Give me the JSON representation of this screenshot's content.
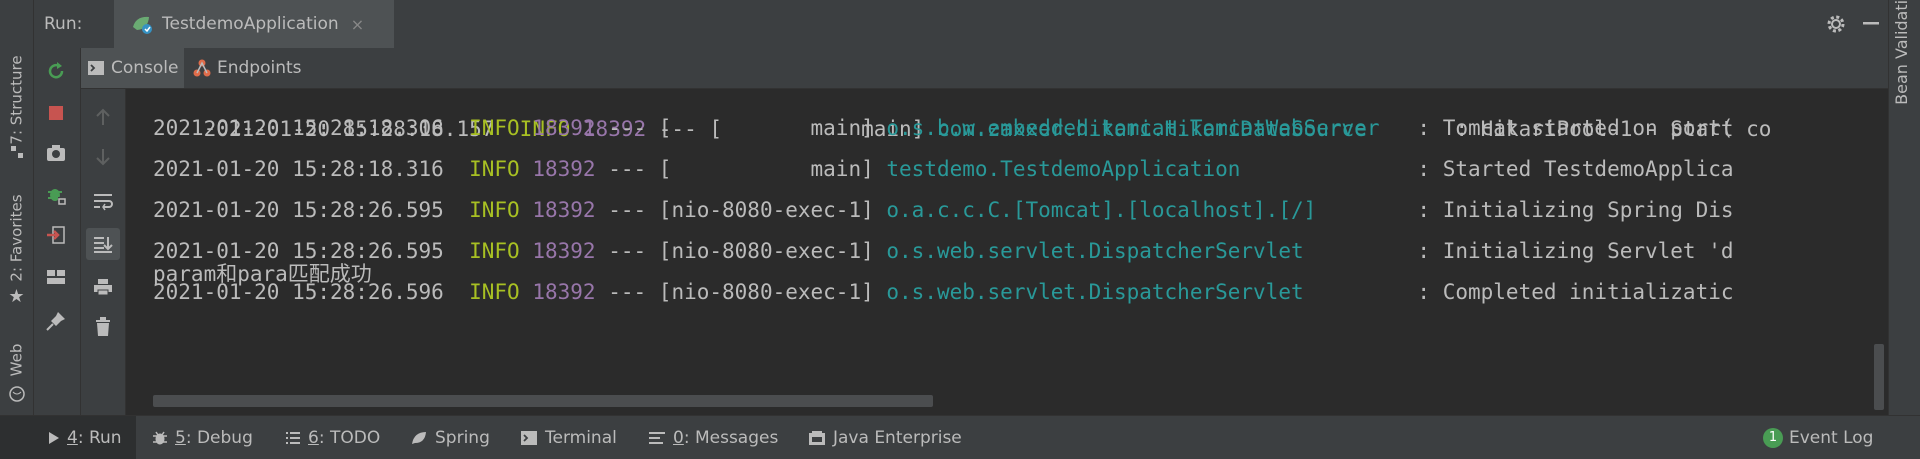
{
  "left_tabs": [
    {
      "label": "7: Structure",
      "icon": "structure-icon"
    },
    {
      "label": "2: Favorites",
      "icon": "star-icon"
    },
    {
      "label": "Web",
      "icon": "web-icon"
    }
  ],
  "right_tab": {
    "label": "Bean Validation"
  },
  "run_panel": {
    "label": "Run:",
    "tab_title": "TestdemoApplication",
    "close_glyph": "×"
  },
  "sub_tabs": [
    {
      "label": "Console",
      "icon": "console-icon"
    },
    {
      "label": "Endpoints",
      "icon": "endpoints-icon"
    }
  ],
  "console": {
    "partial_line": {
      "date": "2021-01-20 15:28:18.157",
      "level": "INFO",
      "pid": "18392",
      "sep": "---",
      "thread": "[           main]",
      "logger": "com.zaxxer.hikari.HikariDataSource",
      "message": ": HikariPool-1 - Start co"
    },
    "lines": [
      {
        "date": "2021-01-20 15:28:18.306",
        "level": "INFO",
        "pid": "18392",
        "sep": "---",
        "thread": "[           main]",
        "logger": "o.s.b.w.embedded.tomcat.TomcatWebServer ",
        "message": ": Tomcat started on port("
      },
      {
        "date": "2021-01-20 15:28:18.316",
        "level": "INFO",
        "pid": "18392",
        "sep": "---",
        "thread": "[           main]",
        "logger": "testdemo.TestdemoApplication            ",
        "message": ": Started TestdemoApplica"
      },
      {
        "date": "2021-01-20 15:28:26.595",
        "level": "INFO",
        "pid": "18392",
        "sep": "---",
        "thread": "[nio-8080-exec-1]",
        "logger": "o.a.c.c.C.[Tomcat].[localhost].[/]      ",
        "message": ": Initializing Spring Dis"
      },
      {
        "date": "2021-01-20 15:28:26.595",
        "level": "INFO",
        "pid": "18392",
        "sep": "---",
        "thread": "[nio-8080-exec-1]",
        "logger": "o.s.web.servlet.DispatcherServlet       ",
        "message": ": Initializing Servlet 'd"
      },
      {
        "date": "2021-01-20 15:28:26.596",
        "level": "INFO",
        "pid": "18392",
        "sep": "---",
        "thread": "[nio-8080-exec-1]",
        "logger": "o.s.web.servlet.DispatcherServlet       ",
        "message": ": Completed initializatic"
      }
    ],
    "output_line": "param和para匹配成功"
  },
  "bottom_tabs": [
    {
      "mnemonic": "4",
      "label": ": Run",
      "icon": "run-icon"
    },
    {
      "mnemonic": "5",
      "label": ": Debug",
      "icon": "debug-icon"
    },
    {
      "mnemonic": "6",
      "label": ": TODO",
      "icon": "todo-icon"
    },
    {
      "mnemonic": "",
      "label": "Spring",
      "icon": "spring-icon"
    },
    {
      "mnemonic": "",
      "label": "Terminal",
      "icon": "terminal-icon"
    },
    {
      "mnemonic": "0",
      "label": ": Messages",
      "icon": "messages-icon"
    },
    {
      "mnemonic": "",
      "label": "Java Enterprise",
      "icon": "java-enterprise-icon"
    }
  ],
  "event_log": {
    "badge": "1",
    "label": "Event Log"
  },
  "colors": {
    "background": "#2b2b2b",
    "panel": "#3c3f41",
    "info": "#a8c023",
    "pid": "#9876aa",
    "logger": "#299999",
    "text": "#bbbbbb"
  }
}
